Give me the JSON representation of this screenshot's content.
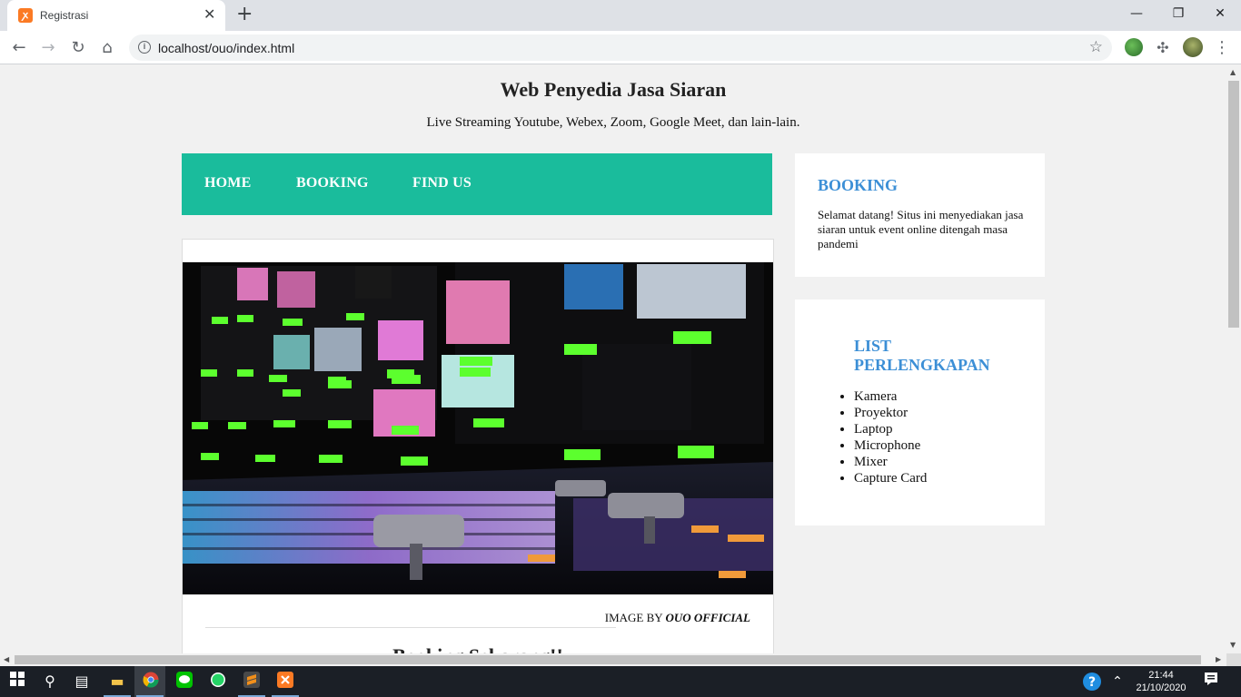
{
  "browser": {
    "tab_title": "Registrasi",
    "tab_close": "✕",
    "new_tab": "+",
    "url": "localhost/ouo/index.html",
    "window_buttons": {
      "minimize": "—",
      "restore": "❐",
      "close": "✕"
    }
  },
  "site": {
    "title": "Web Penyedia Jasa Siaran",
    "tagline": "Live Streaming Youtube, Webex, Zoom, Google Meet, dan lain-lain."
  },
  "menu": {
    "items": [
      "HOME",
      "BOOKING",
      "FIND US"
    ]
  },
  "article": {
    "caption_prefix": "IMAGE BY ",
    "caption_author": "OUO OFFICIAL",
    "heading": "Booking Sekarang!!"
  },
  "sidebar": {
    "booking": {
      "title": "BOOKING",
      "text": "Selamat datang! Situs ini menyediakan jasa siaran untuk event online ditengah masa pandemi"
    },
    "equipment": {
      "title": "LIST PERLENGKAPAN",
      "items": [
        "Kamera",
        "Proyektor",
        "Laptop",
        "Microphone",
        "Mixer",
        "Capture Card"
      ]
    }
  },
  "taskbar": {
    "time": "21:44",
    "date": "21/10/2020"
  },
  "colors": {
    "menu_bg": "#1abc9c",
    "sidebar_title": "#3c8fd6",
    "page_bg": "#f1f1f1"
  }
}
